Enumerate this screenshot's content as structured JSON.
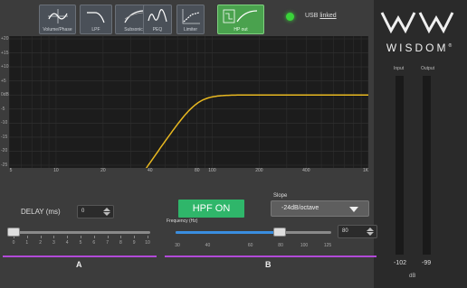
{
  "toolbar": {
    "buttons": [
      {
        "label": "Volume/Phase"
      },
      {
        "label": "LPF"
      },
      {
        "label": "Subsonic"
      },
      {
        "label": "PEQ"
      },
      {
        "label": "Limiter"
      },
      {
        "label": "HP out",
        "active": true
      }
    ],
    "usb_prefix": "USB",
    "usb_status": "linked"
  },
  "graph": {
    "y_ticks": [
      "+20",
      "+15",
      "+10",
      "+5",
      "0dB",
      "-5",
      "-10",
      "-15",
      "-20",
      "-25"
    ],
    "x_ticks": [
      "5",
      "10",
      "20",
      "40",
      "80",
      "100",
      "200",
      "400",
      "1K"
    ],
    "curve_color": "#e8b820",
    "background": "#1c1c1c"
  },
  "brand": {
    "name": "WISDOM",
    "mark": "®"
  },
  "meters": {
    "input_label": "Input",
    "output_label": "Output",
    "input_value": "-102",
    "output_value": "-99",
    "unit": "dB"
  },
  "panel_a": {
    "title": "A",
    "delay_label": "DELAY (ms)",
    "delay_value": "0",
    "slider_ticks": [
      "0",
      "1",
      "2",
      "3",
      "4",
      "5",
      "6",
      "7",
      "8",
      "9",
      "10"
    ],
    "slider_level": 0
  },
  "panel_b": {
    "title": "B",
    "hpf_button": "HPF ON",
    "slope_label": "Slope",
    "slope_value": "-24dB/octave",
    "frequency_label": "Frequency (Hz)",
    "frequency_value": "80",
    "slider_ticks": [
      "30",
      "40",
      "60",
      "80",
      "100",
      "125"
    ]
  },
  "colors": {
    "accent_purple": "#b14ad8",
    "hpf_green": "#2fb66a",
    "active_tool": "#4aa24e",
    "slider_blue": "#3a8ee0",
    "led": "#3ad33a"
  }
}
